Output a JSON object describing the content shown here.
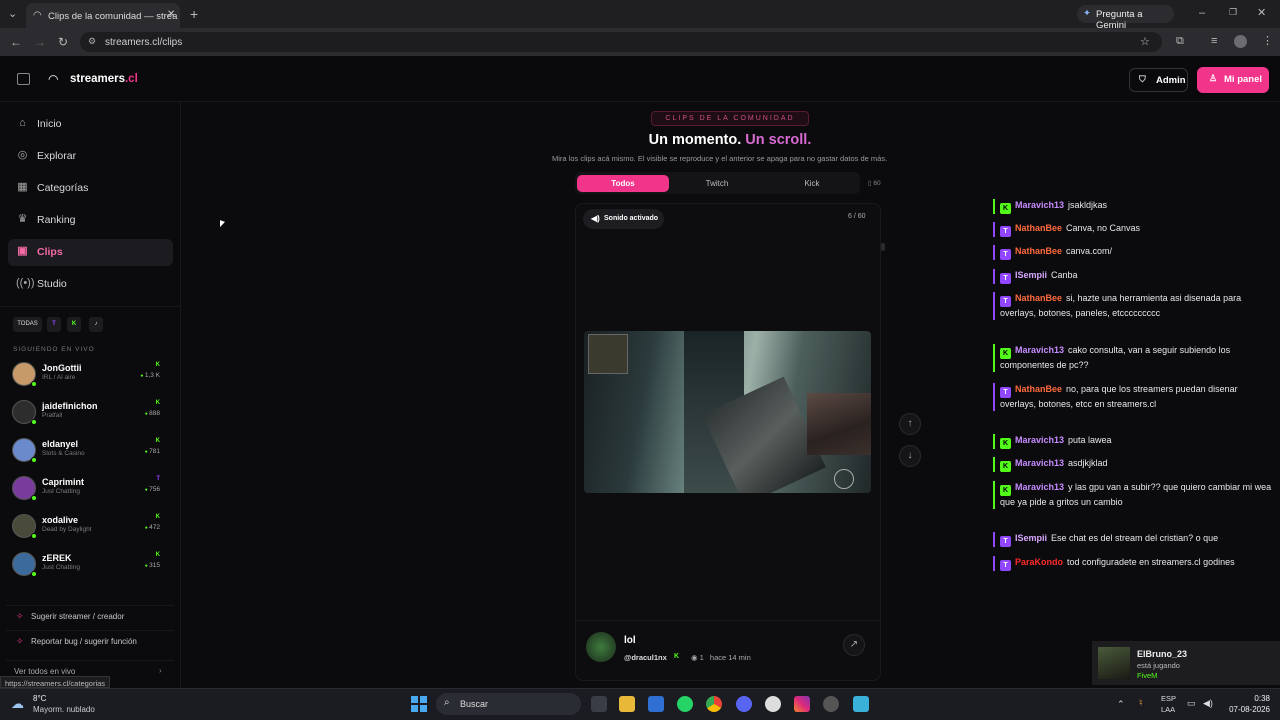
{
  "browser": {
    "tab_title": "Clips de la comunidad — strea",
    "url": "streamers.cl/clips",
    "gemini_label": "Pregunta a Gemini",
    "status_url": "https://streamers.cl/categorias"
  },
  "header": {
    "brand_main": "streamers",
    "brand_suffix": ".cl",
    "admin_label": "Admin",
    "panel_label": "Mi panel"
  },
  "sidebar": {
    "nav": [
      {
        "label": "Inicio",
        "icon": "home-icon"
      },
      {
        "label": "Explorar",
        "icon": "compass-icon"
      },
      {
        "label": "Categorías",
        "icon": "grid-icon"
      },
      {
        "label": "Ranking",
        "icon": "trophy-icon"
      },
      {
        "label": "Clips",
        "icon": "clips-icon"
      },
      {
        "label": "Studio",
        "icon": "broadcast-icon"
      }
    ],
    "filters": [
      "TODAS",
      "T",
      "K",
      "♪"
    ],
    "section_label": "SIGUIENDO EN VIVO",
    "streamers": [
      {
        "name": "JonGottii",
        "game": "IRL / Al aire",
        "platform": "K",
        "viewers": "1,3 K"
      },
      {
        "name": "jaidefinichon",
        "game": "Pratfall",
        "platform": "K",
        "viewers": "888"
      },
      {
        "name": "eldanyel",
        "game": "Slots & Casino",
        "platform": "K",
        "viewers": "781"
      },
      {
        "name": "Caprimint",
        "game": "Just Chatting",
        "platform": "T",
        "viewers": "756"
      },
      {
        "name": "xodalive",
        "game": "Dead by Daylight",
        "platform": "K",
        "viewers": "472"
      },
      {
        "name": "zEREK",
        "game": "Just Chatting",
        "platform": "K",
        "viewers": "315"
      }
    ],
    "suggest_label": "Sugerir streamer / creador",
    "report_label": "Reportar bug / sugerir función",
    "see_all_label": "Ver todos en vivo"
  },
  "main": {
    "pill": "CLIPS DE LA COMUNIDAD",
    "headline_1": "Un momento.",
    "headline_2": "Un scroll.",
    "subtitle": "Mira los clips acá mismo. El visible se reproduce y el anterior se apaga para no gastar datos de más.",
    "tabs": [
      "Todos",
      "Twitch",
      "Kick"
    ],
    "count": "60",
    "sound_label": "Sonido activado",
    "clip_counter": "6 / 60",
    "clip_title": "lol",
    "clip_author": "@dracul1nx",
    "clip_platform": "K",
    "clip_views": "1",
    "clip_time": "hace 14 min"
  },
  "chat": [
    {
      "platform": "K",
      "user": "Maravich13",
      "color": "#c78cff",
      "text": "jsakldjkas"
    },
    {
      "platform": "T",
      "user": "NathanBee",
      "color": "#ff6a3d",
      "text": "Canva, no Canvas"
    },
    {
      "platform": "T",
      "user": "NathanBee",
      "color": "#ff6a3d",
      "text": "canva.com/"
    },
    {
      "platform": "T",
      "user": "ISempii",
      "color": "#d8a8ff",
      "text": "Canba"
    },
    {
      "platform": "T",
      "user": "NathanBee",
      "color": "#ff6a3d",
      "text": "si, hazte una herramienta asi disenada para overlays, botones, paneles, etccccccccc"
    },
    {
      "platform": "K",
      "user": "Maravich13",
      "color": "#c78cff",
      "text": "cako consulta, van a seguir subiendo los componentes de pc??"
    },
    {
      "platform": "T",
      "user": "NathanBee",
      "color": "#ff6a3d",
      "text": "no, para que los streamers puedan disenar overlays, botones, etcc en streamers.cl"
    },
    {
      "platform": "K",
      "user": "Maravich13",
      "color": "#c78cff",
      "text": "puta lawea"
    },
    {
      "platform": "K",
      "user": "Maravich13",
      "color": "#c78cff",
      "text": "asdjkjklad"
    },
    {
      "platform": "K",
      "user": "Maravich13",
      "color": "#c78cff",
      "text": "y las gpu van a subir?? que quiero cambiar mi wea que ya pide a gritos un cambio"
    },
    {
      "platform": "T",
      "user": "ISempii",
      "color": "#d8a8ff",
      "text": "Ese chat es del stream del cristian? o que"
    },
    {
      "platform": "T",
      "user": "ParaKondo",
      "color": "#ff2a2a",
      "text": "tod configuradete en streamers.cl godines"
    }
  ],
  "notification": {
    "name": "ElBruno_23",
    "status": "está jugando",
    "game": "FiveM"
  },
  "taskbar": {
    "temp": "8°C",
    "weather": "Mayorm. nublado",
    "search": "Buscar",
    "lang1": "ESP",
    "lang2": "LAA",
    "time": "0:38",
    "date": "07-08-2026"
  },
  "colors": {
    "accent": "#f0358b",
    "kick": "#53fc18",
    "twitch": "#9146ff"
  }
}
